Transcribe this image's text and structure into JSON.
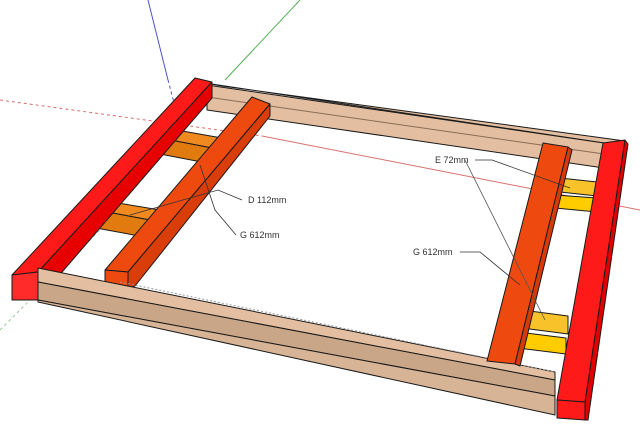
{
  "colors": {
    "background": "#ffffff",
    "red_beam_top": "#ff1a1a",
    "red_beam_side": "#d00000",
    "orange_beam_top": "#ee4a0f",
    "orange_beam_side": "#c7360a",
    "wood_top": "#e3bea0",
    "wood_side": "#c9a688",
    "block_D": "#e27b0f",
    "block_E": "#f5b00b",
    "axis_red": "#d97070",
    "axis_green": "#55b055",
    "axis_blue": "#5050d0",
    "edge": "#1a1a1a"
  },
  "labels": {
    "d": "D 112mm",
    "g_left": "G 612mm",
    "e": "E 72mm",
    "g_right": "G 612mm"
  }
}
